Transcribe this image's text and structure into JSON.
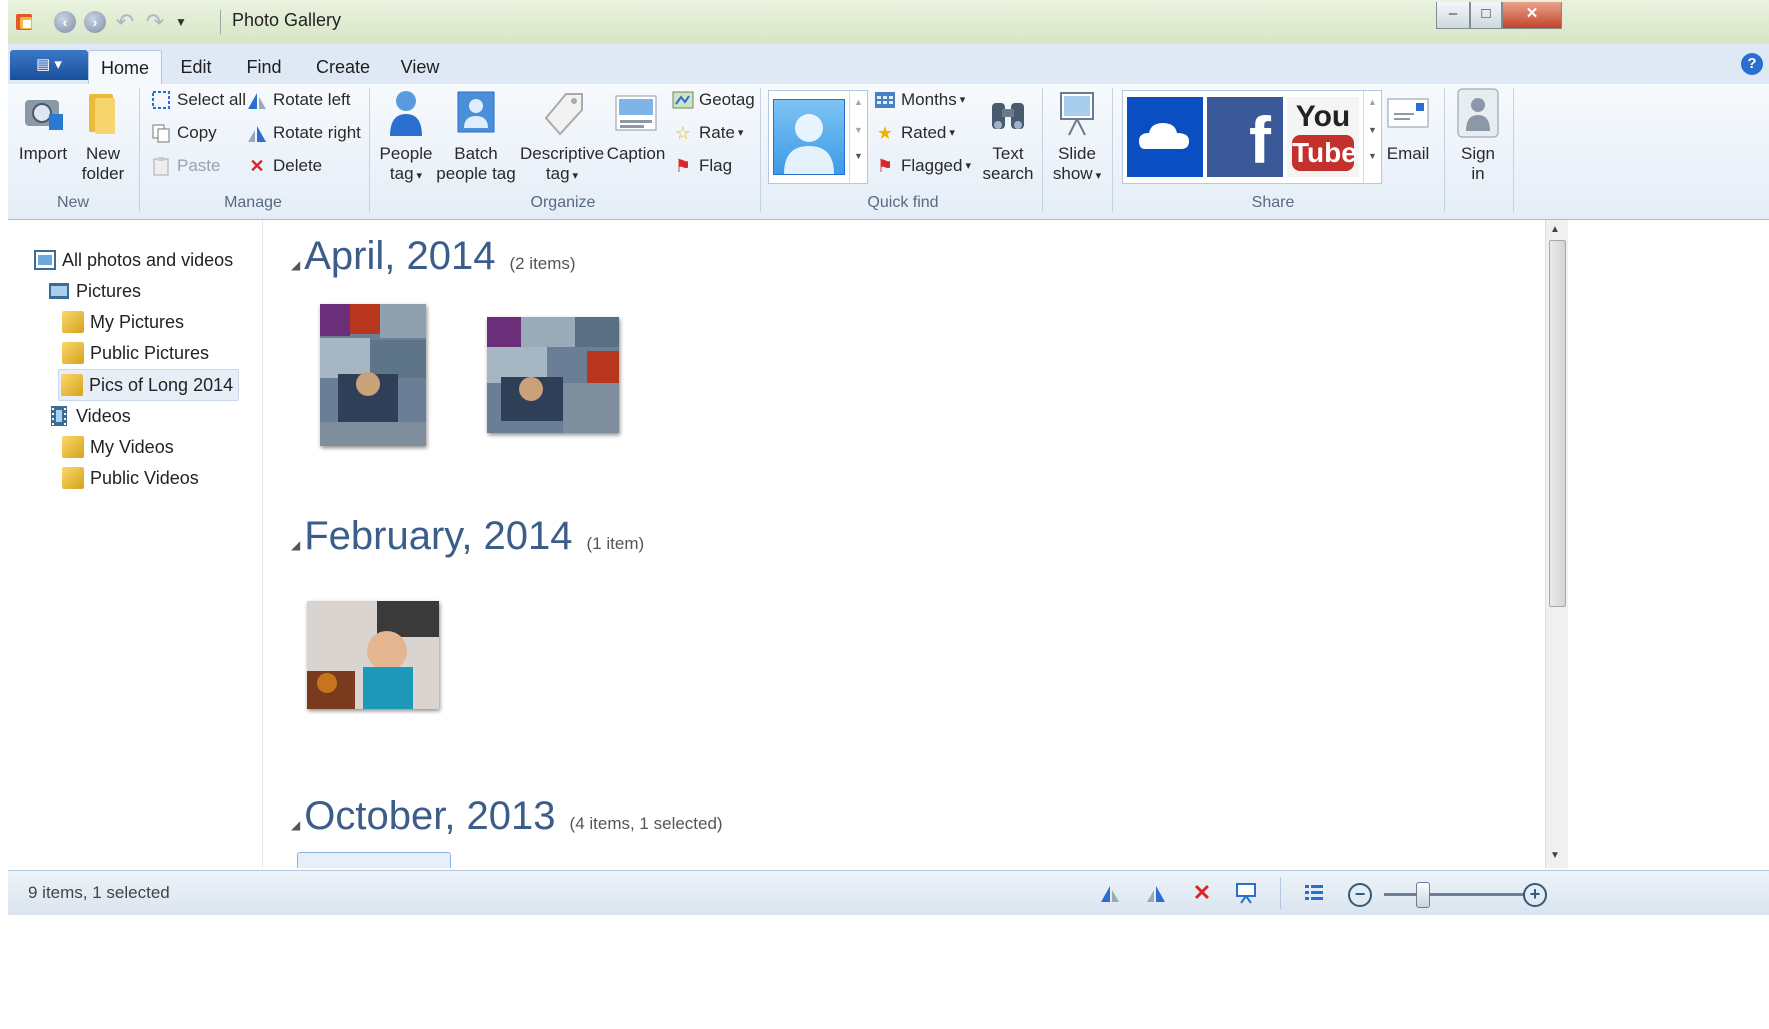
{
  "window": {
    "title": "Photo Gallery",
    "minimize": "▭",
    "maximize": "□",
    "close": "✕"
  },
  "qat": [
    "app-icon",
    "back-icon",
    "forward-icon",
    "undo-icon",
    "redo-icon",
    "customize-icon"
  ],
  "tabs": [
    {
      "label": "Home",
      "active": true
    },
    {
      "label": "Edit"
    },
    {
      "label": "Find"
    },
    {
      "label": "Create"
    },
    {
      "label": "View"
    }
  ],
  "ribbon": {
    "groups": {
      "new": "New",
      "manage": "Manage",
      "organize": "Organize",
      "quickfind": "Quick find",
      "share": "Share"
    },
    "new": {
      "import": "Import",
      "new_folder_1": "New",
      "new_folder_2": "folder"
    },
    "manage": {
      "select_all": "Select all",
      "copy": "Copy",
      "paste": "Paste",
      "rotate_left": "Rotate left",
      "rotate_right": "Rotate right",
      "delete": "Delete"
    },
    "organize": {
      "people_tag_1": "People",
      "people_tag_2": "tag",
      "batch_1": "Batch",
      "batch_2": "people tag",
      "desc_1": "Descriptive",
      "desc_2": "tag",
      "caption": "Caption",
      "geotag": "Geotag",
      "rate": "Rate",
      "flag": "Flag"
    },
    "quickfind": {
      "months": "Months",
      "rated": "Rated",
      "flagged": "Flagged",
      "text_search_1": "Text",
      "text_search_2": "search"
    },
    "slideshow": {
      "l1": "Slide",
      "l2": "show"
    },
    "share": {
      "youtube_1": "You",
      "youtube_2": "Tube",
      "email": "Email",
      "sign_in_1": "Sign",
      "sign_in_2": "in"
    }
  },
  "nav": [
    {
      "label": "All photos and videos",
      "icon": "gallery-icon"
    },
    {
      "label": "Pictures",
      "icon": "pictures-icon"
    },
    {
      "label": "My Pictures",
      "icon": "folder-icon"
    },
    {
      "label": "Public Pictures",
      "icon": "folder-icon"
    },
    {
      "label": "Pics of Long 2014",
      "icon": "folder-icon",
      "selected": true
    },
    {
      "label": "Videos",
      "icon": "videos-icon"
    },
    {
      "label": "My Videos",
      "icon": "folder-icon"
    },
    {
      "label": "Public Videos",
      "icon": "folder-icon"
    }
  ],
  "groups": [
    {
      "month": "April, 2014",
      "count": "(2 items)"
    },
    {
      "month": "February, 2014",
      "count": "(1 item)"
    },
    {
      "month": "October, 2013",
      "count": "(4 items, 1 selected)"
    }
  ],
  "status": {
    "text": "9 items, 1 selected"
  },
  "colors": {
    "accent": "#3b5d8a",
    "title_bar": "#d7e6c6",
    "ribbon": "#e4edf7",
    "onedrive": "#0a4fc2",
    "facebook": "#3b5998",
    "youtube": "#c4302b"
  }
}
